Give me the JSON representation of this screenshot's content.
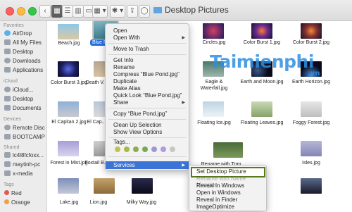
{
  "window": {
    "title": "Desktop Pictures"
  },
  "toolbar": {
    "view_icons": "▦",
    "view_list": "☰",
    "view_columns": "▥",
    "view_cover": "▭",
    "arrange": "▦ ▾",
    "action": "✱ ▾",
    "share": "⇪",
    "tags": "◯"
  },
  "sidebar": {
    "favorites_heading": "Favorites",
    "favorites": [
      "AirDrop",
      "All My Files",
      "Desktop",
      "Downloads",
      "Applications"
    ],
    "icloud_heading": "iCloud",
    "icloud": [
      "iCloud...",
      "Desktop",
      "Documents"
    ],
    "devices_heading": "Devices",
    "devices": [
      "Remote Disc",
      "BOOTCAMP"
    ],
    "shared_heading": "Shared",
    "shared": [
      "lc4l8fcfoxx...",
      "maytinh-pc",
      "x-media"
    ],
    "tags_heading": "Tags",
    "tags": [
      "Red",
      "Orange"
    ]
  },
  "files": {
    "row1": [
      "Beach.jpg",
      "Blue Po...",
      "",
      "Circles.jpg",
      "Color Burst 1.jpg",
      "Color Burst 2.jpg"
    ],
    "row2": [
      "Color Burst 3.jpg",
      "Death V...",
      "",
      "Eagle & Waterfall.jpg",
      "Earth and Moon.jpg",
      "Earth Horizon.jpg"
    ],
    "row3": [
      "El Capitan 2.jpg",
      "El Cap...",
      "",
      "Floating Ice.jpg",
      "Floating Leaves.jpg",
      "Foggy Forest.jpg"
    ],
    "row4": [
      "Forest in Mist.jpg",
      "Foxtail B...",
      "Rename with Tran ...",
      "",
      "Isles.jpg",
      ""
    ],
    "row5": [
      "Lake.jpg",
      "Lion.jpg",
      "Milky Way.jpg",
      "",
      "",
      ""
    ]
  },
  "context_menu": {
    "open": "Open",
    "open_with": "Open With",
    "move_to_trash": "Move to Trash",
    "get_info": "Get Info",
    "rename": "Rename",
    "compress": "Compress “Blue Pond.jpg”",
    "duplicate": "Duplicate",
    "make_alias": "Make Alias",
    "quick_look": "Quick Look “Blue Pond.jpg”",
    "share": "Share",
    "copy": "Copy “Blue Pond.jpg”",
    "clean_up": "Clean Up Selection",
    "show_view_options": "Show View Options",
    "tags": "Tags...",
    "services": "Services"
  },
  "tag_colors": [
    "#e05a4f",
    "#f0a040",
    "#c9c93a",
    "#7fbf5a",
    "#6aa0e6",
    "#a58ae0",
    "#a0a0a0"
  ],
  "services_submenu": {
    "set_desktop_picture": "Set Desktop Picture",
    "rename_with": "Rename with Name Mangler",
    "reveal_in_windows": "Reveal in Windows",
    "open_in_windows": "Open in Windows",
    "reveal_in_finder": "Reveal in Finder",
    "image_optimize": "ImageOptimize"
  },
  "watermark": {
    "main": "Taimienphi",
    "suffix": ".vn"
  }
}
